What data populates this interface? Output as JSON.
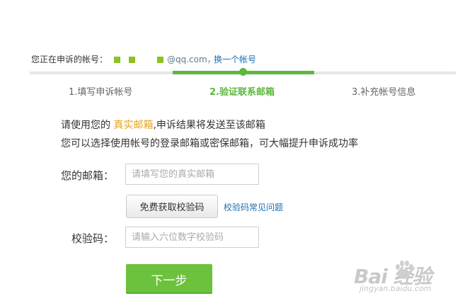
{
  "account": {
    "prefix": "您正在申诉的帐号：",
    "suffix": "@qq.com，",
    "switch_link": "换一个帐号"
  },
  "steps": [
    {
      "label": "1.填写申诉帐号",
      "active": false
    },
    {
      "label": "2.验证联系邮箱",
      "active": true
    },
    {
      "label": "3.补充帐号信息",
      "active": false
    }
  ],
  "progress_fraction": 0.5,
  "intro": {
    "line1_pre": "请使用您的 ",
    "line1_highlight": "真实邮箱",
    "line1_post": ",申诉结果将发送至该邮箱",
    "line2": "您可以选择使用帐号的登录邮箱或密保邮箱，可大幅提升申诉成功率"
  },
  "form": {
    "email_label": "您的邮箱：",
    "email_placeholder": "请填写您的真实邮箱",
    "email_value": "",
    "get_code_button": "免费获取校验码",
    "code_faq_link": "校验码常见问题",
    "code_label": "校验码：",
    "code_placeholder": "请输入六位数字校验码",
    "code_value": ""
  },
  "next_button": "下一步",
  "watermark": {
    "logo": "Bai  经验",
    "site": "jingyan.baidu.com"
  },
  "colors": {
    "accent_green": "#5cb83d",
    "button_green": "#6cc23c",
    "highlight_orange": "#e4a317",
    "link_blue": "#1a6fb3",
    "mask_green": "#8dc21f"
  }
}
